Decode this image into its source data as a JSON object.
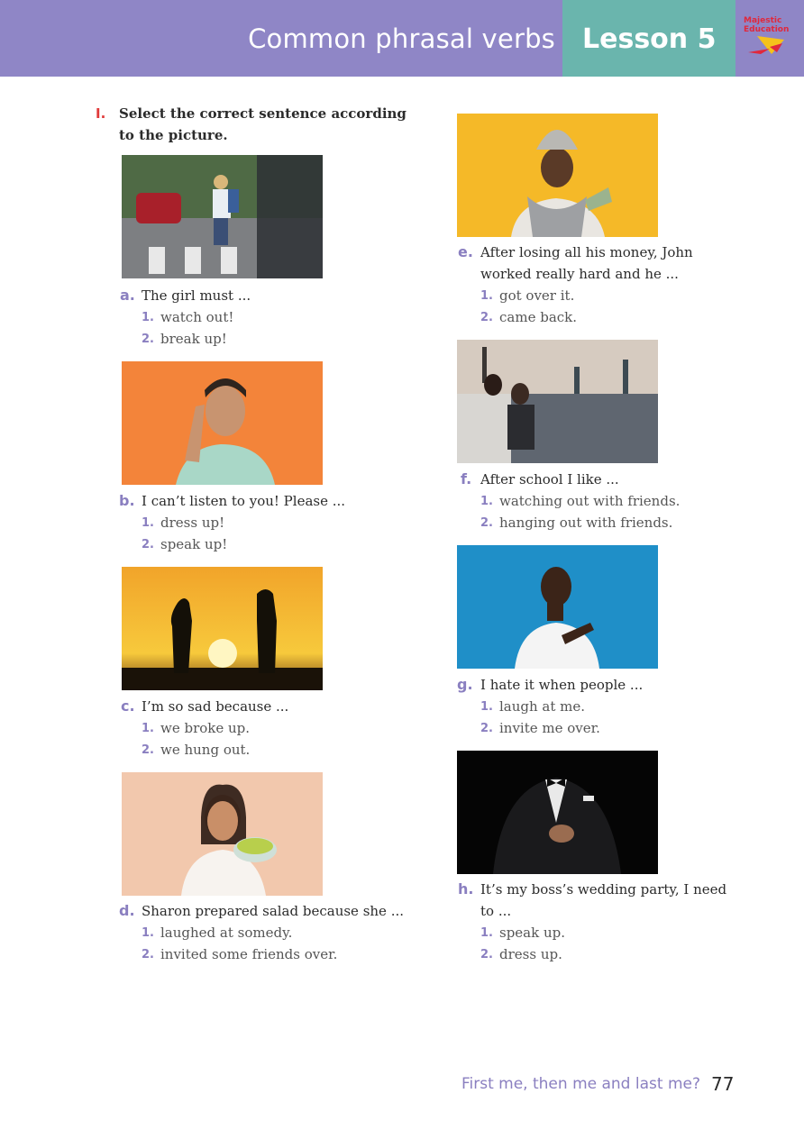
{
  "header": {
    "title": "Common phrasal verbs",
    "lesson": "Lesson 5",
    "logo_line1": "Majestic",
    "logo_line2": "Education"
  },
  "exercise": {
    "number": "I.",
    "instruction": "Select the correct sentence according to the picture."
  },
  "questions": [
    {
      "letter": "a.",
      "text": [
        "The girl must ..."
      ],
      "options": [
        {
          "num": "1.",
          "text": "watch out!"
        },
        {
          "num": "2.",
          "text": "break up!"
        }
      ]
    },
    {
      "letter": "b.",
      "text": [
        "I can’t listen to you! Please ..."
      ],
      "options": [
        {
          "num": "1.",
          "text": "dress up!"
        },
        {
          "num": "2.",
          "text": "speak up!"
        }
      ]
    },
    {
      "letter": "c.",
      "text": [
        "I’m so sad because ..."
      ],
      "options": [
        {
          "num": "1.",
          "text": "we broke up."
        },
        {
          "num": "2.",
          "text": "we hung out."
        }
      ]
    },
    {
      "letter": "d.",
      "text": [
        "Sharon prepared salad because she ..."
      ],
      "options": [
        {
          "num": "1.",
          "text": "laughed at somedy."
        },
        {
          "num": "2.",
          "text": "invited some friends over."
        }
      ]
    },
    {
      "letter": "e.",
      "text": [
        "After losing all his money, John",
        "worked really hard and he ..."
      ],
      "options": [
        {
          "num": "1.",
          "text": "got over it."
        },
        {
          "num": "2.",
          "text": "came back."
        }
      ]
    },
    {
      "letter": "f.",
      "text": [
        "After school I like ..."
      ],
      "options": [
        {
          "num": "1.",
          "text": "watching out with friends."
        },
        {
          "num": "2.",
          "text": "hanging out with friends."
        }
      ]
    },
    {
      "letter": "g.",
      "text": [
        "I hate it when people ..."
      ],
      "options": [
        {
          "num": "1.",
          "text": "laugh at me."
        },
        {
          "num": "2.",
          "text": "invite me over."
        }
      ]
    },
    {
      "letter": "h.",
      "text": [
        "It’s my boss’s wedding party, I need",
        "to ..."
      ],
      "options": [
        {
          "num": "1.",
          "text": "speak up."
        },
        {
          "num": "2.",
          "text": "dress up."
        }
      ]
    }
  ],
  "footer": {
    "text": "First me, then me and last me?",
    "page_number": "77"
  },
  "colors": {
    "header_band": "#8f86c6",
    "lesson_block": "#6ab5ad",
    "accent_letters": "#8a7fc0",
    "exercise_number": "#e03a3a"
  }
}
